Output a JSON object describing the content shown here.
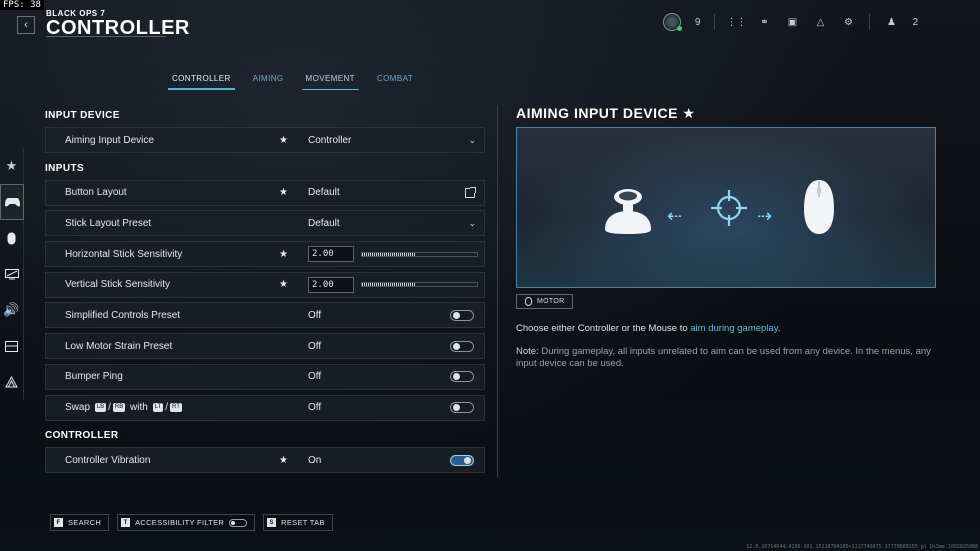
{
  "fps": "FPS:  38",
  "header": {
    "game_name": "BLACK OPS 7",
    "title": "CONTROLLER",
    "back_icon": "chevron-left-icon"
  },
  "topbar": {
    "level": "9",
    "party_count": "2",
    "icons": [
      "avatar-icon",
      "grid-icon",
      "lock-icon",
      "camera-icon",
      "bell-icon",
      "gear-icon",
      "party-icon"
    ]
  },
  "tabs": [
    {
      "label": "CONTROLLER",
      "active": true
    },
    {
      "label": "AIMING"
    },
    {
      "label": "MOVEMENT"
    },
    {
      "label": "COMBAT"
    }
  ],
  "leftnav": [
    "star-icon",
    "controller-icon",
    "mouse-icon",
    "display-icon",
    "speaker-icon",
    "interface-icon",
    "network-icon"
  ],
  "sections": {
    "input_device": "INPUT DEVICE",
    "inputs": "INPUTS",
    "controller": "CONTROLLER"
  },
  "settings": {
    "aiming_input_device": {
      "label": "Aiming Input Device",
      "value": "Controller"
    },
    "button_layout": {
      "label": "Button Layout",
      "value": "Default"
    },
    "stick_layout_preset": {
      "label": "Stick Layout Preset",
      "value": "Default"
    },
    "horizontal_sensitivity": {
      "label": "Horizontal Stick Sensitivity",
      "value": "2.00",
      "slider_fraction": 0.47
    },
    "vertical_sensitivity": {
      "label": "Vertical Stick Sensitivity",
      "value": "2.00",
      "slider_fraction": 0.47
    },
    "simplified_controls": {
      "label": "Simplified Controls Preset",
      "value": "Off"
    },
    "low_motor_strain": {
      "label": "Low Motor Strain Preset",
      "value": "Off"
    },
    "bumper_ping": {
      "label": "Bumper Ping",
      "value": "Off"
    },
    "swap": {
      "label_prefix": "Swap",
      "glyph_lb": "LB",
      "glyph_rb": "RB",
      "label_with": "with",
      "glyph_lt": "LT",
      "glyph_rt": "RT",
      "slash": "/",
      "value": "Off"
    },
    "controller_vibration": {
      "label": "Controller Vibration",
      "value": "On"
    }
  },
  "detail": {
    "title": "AIMING INPUT DEVICE ★",
    "tag": "MOTOR",
    "desc_prefix": "Choose either Controller or the Mouse to ",
    "desc_link": "aim during gameplay",
    "desc_suffix": ".",
    "note_label": "Note:",
    "note_text": " During gameplay, all inputs unrelated to aim can be used from any device. In the menus, any input device can be used."
  },
  "footer": {
    "search": {
      "key": "F",
      "label": "SEARCH"
    },
    "accessibility": {
      "key": "T",
      "label": "ACCESSIBILITY FILTER"
    },
    "reset": {
      "key": "S",
      "label": "RESET TAB"
    }
  },
  "build_string": "12.8.26714644.4190-101.15228704105+1117740075.17778689155 pl Ds3me.1002826888"
}
